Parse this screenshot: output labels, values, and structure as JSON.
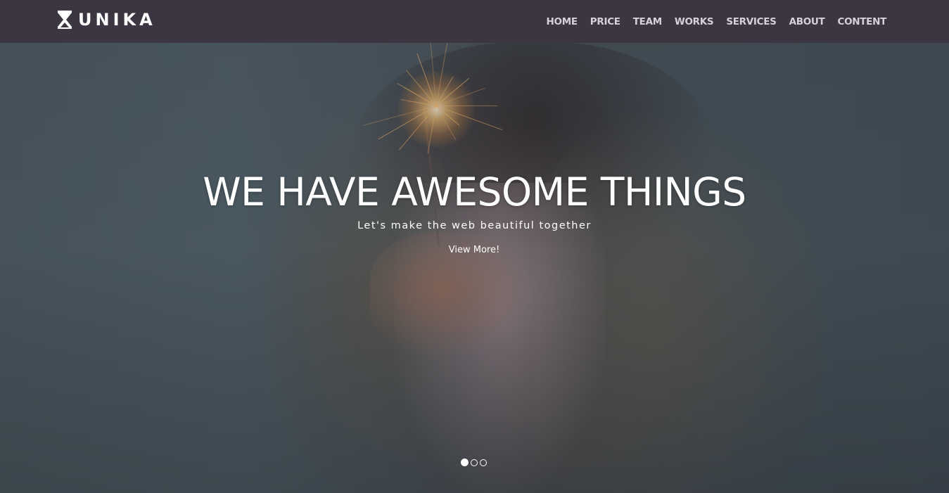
{
  "brand": {
    "name": "UNIKA",
    "logo_icon": "hourglass-icon"
  },
  "nav": {
    "items": [
      {
        "label": "HOME"
      },
      {
        "label": "PRICE"
      },
      {
        "label": "TEAM"
      },
      {
        "label": "WORKS"
      },
      {
        "label": "SERVICES"
      },
      {
        "label": "ABOUT"
      },
      {
        "label": "CONTENT"
      }
    ]
  },
  "hero": {
    "title": "WE HAVE AWESOME THINGS",
    "subtitle": "Let's make the web beautiful together",
    "cta_label": "View More!",
    "background_image": "woman-holding-sparkler",
    "slides_total": 3,
    "active_slide": 1
  },
  "colors": {
    "navbar_bg": "#3b3642",
    "nav_text": "#d4d2d8",
    "hero_text": "#ffffff"
  }
}
